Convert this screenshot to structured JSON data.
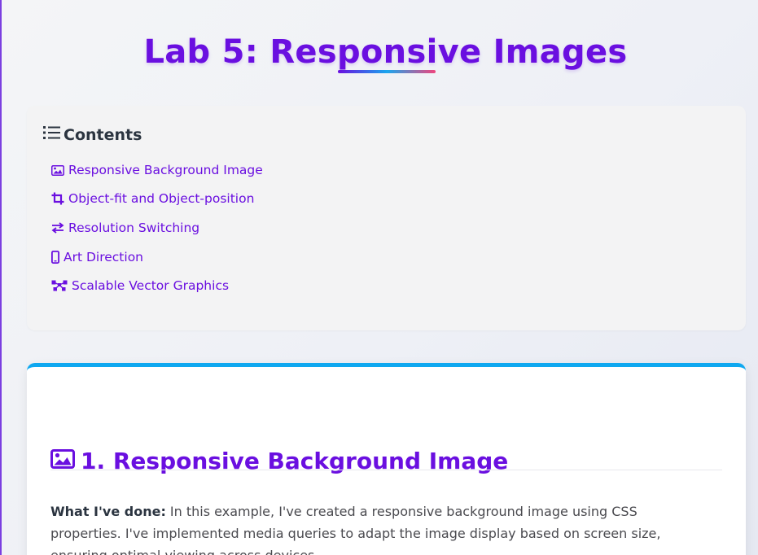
{
  "page": {
    "title": "Lab 5: Responsive Images"
  },
  "toc": {
    "heading": "Contents",
    "heading_icon": "list-icon",
    "items": [
      {
        "label": "Responsive Background Image",
        "icon": "image-icon"
      },
      {
        "label": "Object-fit and Object-position",
        "icon": "crop-icon"
      },
      {
        "label": "Resolution Switching",
        "icon": "exchange-arrows-icon"
      },
      {
        "label": "Art Direction",
        "icon": "mobile-icon"
      },
      {
        "label": "Scalable Vector Graphics",
        "icon": "vector-square-icon"
      }
    ]
  },
  "section1": {
    "heading": "1. Responsive Background Image",
    "heading_icon": "image-icon",
    "intro_label": "What I've done:",
    "intro_text": " In this example, I've created a responsive background image using CSS properties. I've implemented media queries to adapt the image display based on screen size, ensuring optimal viewing across devices."
  },
  "colors": {
    "accent": "#6a0fe0",
    "card_top_border": "#0fa8f0",
    "underline_gradient": [
      "#6a0fe0",
      "#1aa6ee",
      "#f0457d"
    ],
    "text_dark": "#2b3440",
    "toc_background": "#f3f3f4"
  }
}
